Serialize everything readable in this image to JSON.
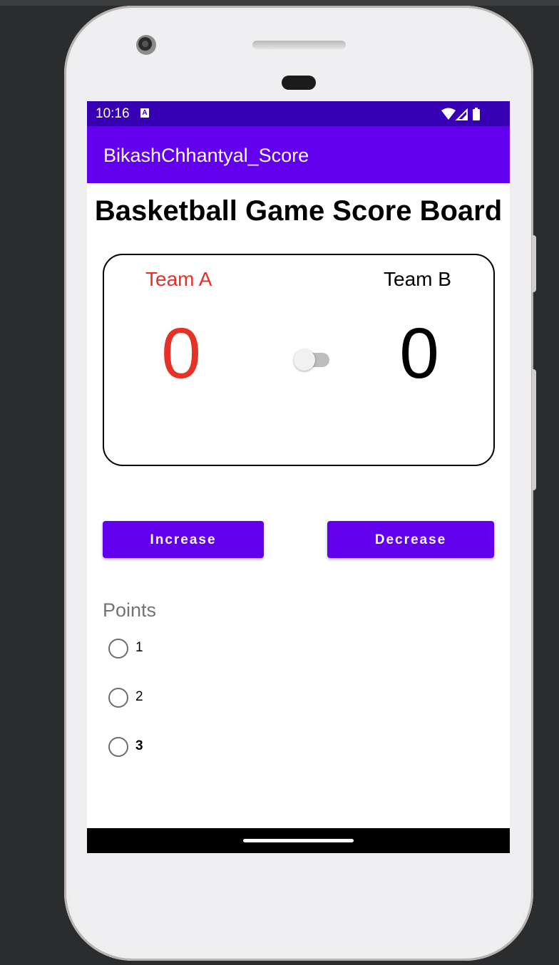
{
  "status_bar": {
    "time": "10:16",
    "notification_icon": "a-notification-icon",
    "icons": [
      "wifi-icon",
      "signal-icon",
      "battery-icon"
    ]
  },
  "app_bar": {
    "title": "BikashChhantyal_Score"
  },
  "page": {
    "title": "Basketball Game Score Board"
  },
  "scoreboard": {
    "team_a": {
      "name": "Team A",
      "score": "0",
      "color": "#e53126"
    },
    "team_b": {
      "name": "Team B",
      "score": "0",
      "color": "#000000"
    },
    "switch": {
      "checked": false
    }
  },
  "buttons": {
    "increase": "Increase",
    "decrease": "Decrease"
  },
  "points": {
    "label": "Points",
    "options": [
      {
        "label": "1",
        "selected": false
      },
      {
        "label": "2",
        "selected": false
      },
      {
        "label": "3",
        "selected": false
      }
    ]
  },
  "colors": {
    "primary": "#6200ee",
    "primary_dark": "#3700b3",
    "team_a": "#e53126"
  }
}
